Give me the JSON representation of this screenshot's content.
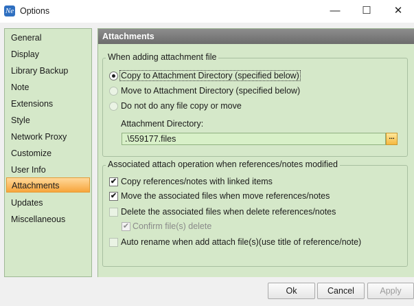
{
  "window": {
    "icon_text": "Ne",
    "title": "Options",
    "minimize_glyph": "—",
    "maximize_glyph": "☐",
    "close_glyph": "✕"
  },
  "sidebar": {
    "items": [
      {
        "label": "General"
      },
      {
        "label": "Display"
      },
      {
        "label": "Library Backup"
      },
      {
        "label": "Note"
      },
      {
        "label": "Extensions"
      },
      {
        "label": "Style"
      },
      {
        "label": "Network Proxy"
      },
      {
        "label": "Customize"
      },
      {
        "label": "User Info"
      },
      {
        "label": "Attachments",
        "selected": true
      },
      {
        "label": "Updates"
      },
      {
        "label": "Miscellaneous"
      }
    ]
  },
  "panel": {
    "title": "Attachments",
    "adding_group": {
      "legend": "When adding attachment file",
      "options": [
        {
          "label": "Copy to Attachment Directory (specified below)",
          "selected": true
        },
        {
          "label": "Move to Attachment Directory (specified below)",
          "selected": false
        },
        {
          "label": "Do not do any file copy or move",
          "selected": false
        }
      ],
      "directory_label": "Attachment Directory:",
      "directory_value": ".\\559177.files",
      "browse_label": "..."
    },
    "assoc_group": {
      "legend": "Associated attach operation when references/notes modified",
      "copy_linked": "Copy references/notes with linked items",
      "move_files": "Move the associated files when move references/notes",
      "delete_files": "Delete the associated files when delete references/notes",
      "confirm_delete": "Confirm file(s) delete",
      "auto_rename": "Auto rename when add  attach file(s)(use title of reference/note)",
      "check_glyph": "✔"
    }
  },
  "buttons": {
    "ok": "Ok",
    "cancel": "Cancel",
    "apply": "Apply"
  },
  "colors": {
    "panel_green": "#d5e8c9",
    "header_gray": "#7a7a7a",
    "selected_orange": "#f7a53c"
  }
}
